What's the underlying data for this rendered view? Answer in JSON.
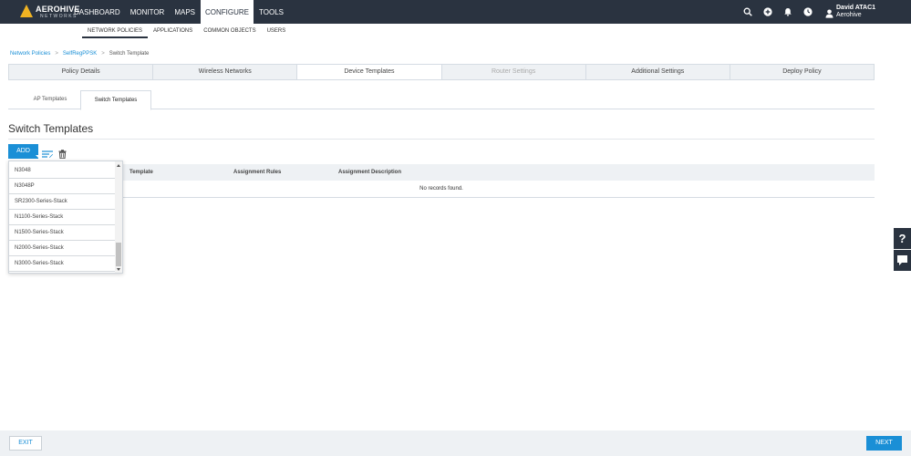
{
  "brand": {
    "name": "AEROHIVE",
    "sub": "NETWORKS",
    "accent": "#f0b323",
    "primary": "#1a8fd6",
    "topbar": "#2a3340"
  },
  "nav": {
    "items": [
      {
        "label": "DASHBOARD"
      },
      {
        "label": "MONITOR"
      },
      {
        "label": "MAPS"
      },
      {
        "label": "CONFIGURE",
        "active": true
      },
      {
        "label": "TOOLS"
      }
    ]
  },
  "top_icons": [
    "search-icon",
    "add-circle-icon",
    "bell-icon",
    "clock-icon"
  ],
  "user": {
    "name": "David ATAC1",
    "org": "Aerohive"
  },
  "subnav": {
    "items": [
      {
        "label": "NETWORK POLICIES",
        "active": true
      },
      {
        "label": "APPLICATIONS"
      },
      {
        "label": "COMMON OBJECTS"
      },
      {
        "label": "USERS"
      }
    ]
  },
  "breadcrumb": {
    "items": [
      "Network Policies",
      "SelfRegPPSK",
      "Switch Template"
    ]
  },
  "steps": {
    "items": [
      {
        "label": "Policy Details"
      },
      {
        "label": "Wireless Networks"
      },
      {
        "label": "Device Templates",
        "active": true
      },
      {
        "label": "Router Settings",
        "disabled": true
      },
      {
        "label": "Additional Settings"
      },
      {
        "label": "Deploy Policy"
      }
    ]
  },
  "template_tabs": {
    "items": [
      {
        "label": "AP Templates"
      },
      {
        "label": "Switch Templates",
        "active": true
      }
    ]
  },
  "page_title": "Switch Templates",
  "add_label": "ADD",
  "table": {
    "columns": [
      "Template",
      "Assignment Rules",
      "Assignment Description"
    ],
    "empty_text": "No records found."
  },
  "dropdown": {
    "options": [
      "N3048",
      "N3048P",
      "SR2300-Series-Stack",
      "N1100-Series-Stack",
      "N1500-Series-Stack",
      "N2000-Series-Stack",
      "N3000-Series-Stack"
    ]
  },
  "side": {
    "help_label": "?"
  },
  "footer": {
    "exit_label": "EXIT",
    "next_label": "NEXT"
  }
}
